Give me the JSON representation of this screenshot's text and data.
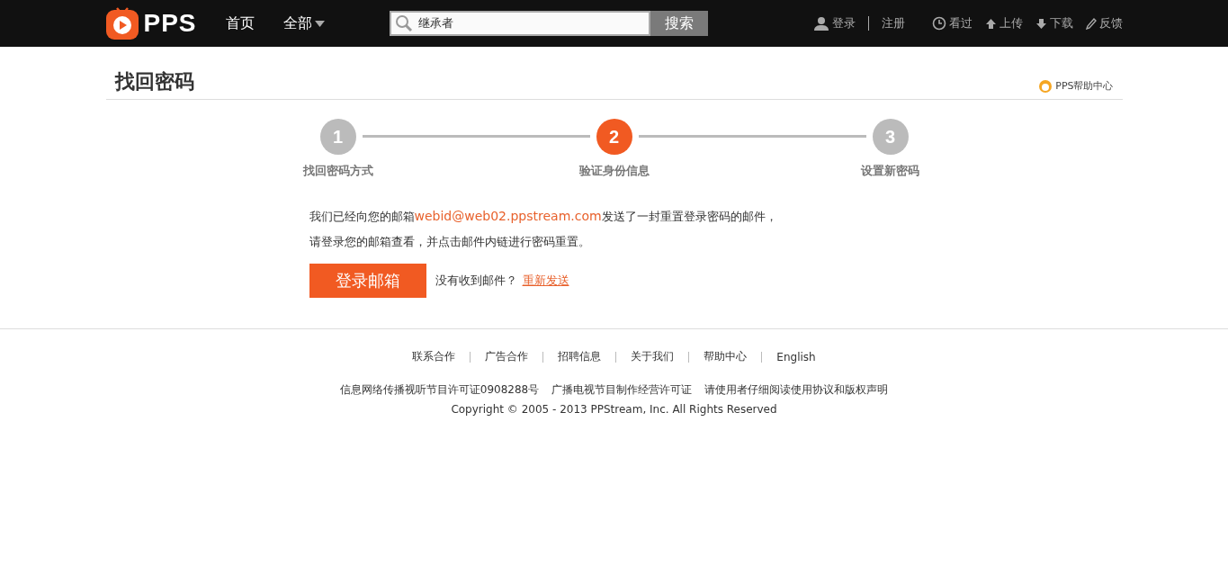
{
  "topbar": {
    "logo": "PPS",
    "nav": [
      {
        "label": "首页",
        "dropdown": false
      },
      {
        "label": "全部",
        "dropdown": true
      }
    ],
    "search": {
      "value": "继承者",
      "button": "搜索"
    },
    "account": [
      "登录",
      "注册"
    ],
    "tools": [
      {
        "kind": "history",
        "label": "看过"
      },
      {
        "kind": "upload",
        "label": "上传"
      },
      {
        "kind": "download",
        "label": "下载"
      },
      {
        "kind": "feedback",
        "label": "反馈"
      }
    ]
  },
  "page": {
    "title": "找回密码",
    "help": "PPS帮助中心"
  },
  "steps": [
    {
      "number": "1",
      "label": "找回密码方式",
      "selected": false
    },
    {
      "number": "2",
      "label": "验证身份信息",
      "selected": true
    },
    {
      "number": "3",
      "label": "设置新密码",
      "selected": false
    }
  ],
  "message": {
    "before": "我们已经向您的邮箱",
    "email": "webid@web02.ppstream.com",
    "after": "发送了一封重置登录密码的邮件，",
    "line2": "请登录您的邮箱查看，并点击邮件内链进行密码重置。"
  },
  "actions": {
    "button": "登录邮箱",
    "prompt": "没有收到邮件？",
    "resend": "重新发送"
  },
  "footer": {
    "links": [
      "联系合作",
      "广告合作",
      "招聘信息",
      "关于我们",
      "帮助中心",
      "English"
    ],
    "licenses": [
      "信息网络传播视听节目许可证0908288号",
      "广播电视节目制作经营许可证",
      "请使用者仔细阅读使用协议和版权声明"
    ],
    "copyright": "Copyright © 2005 - 2013 PPStream, Inc. All Rights Reserved"
  }
}
